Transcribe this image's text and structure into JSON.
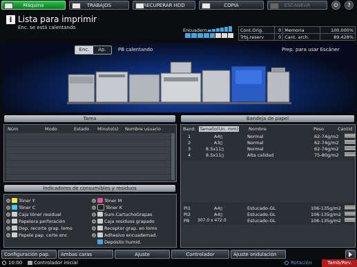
{
  "top_tabs": {
    "maquina": "Máquina",
    "trabajos": "TRABAJOS",
    "recuperar_hdd": "RECUPERAR HDD",
    "copia": "COPIA",
    "escanear": "ESCANEAR"
  },
  "status": {
    "title": "Lista para imprimir",
    "subtitle": "Enc. se está calentando",
    "toner_label": "Encuadern."
  },
  "counters": {
    "cont_orig_label": "Cont.Orig.",
    "cont_orig_value": "0",
    "memoria_label": "Memoria",
    "memoria_value": "100.000%",
    "trbj_reserv_label": "Trbj.reserv",
    "trbj_reserv_value": "0",
    "cant_arch_label": "Cant. arch.",
    "cant_arch_value": "89.428%"
  },
  "machine": {
    "enc_label": "Enc.",
    "ap_label": "Ap.",
    "pb_status": "PB calentando",
    "scanner_status": "Prep. para usar Escáner"
  },
  "tarea": {
    "header": "Tarea",
    "columns": [
      "Núm",
      "Modo",
      "Estado",
      "Minuto(s)",
      "Nombre usuario"
    ]
  },
  "consumibles": {
    "header": "Indicadores de consumibles y residuos",
    "left": [
      "Tóner Y",
      "Tóner C",
      "Caja tóner residual",
      "Papelera perforación",
      "Dep. recorte grap. lomo",
      "Papele pap. corte enc"
    ],
    "right": [
      "Tóner M",
      "Tóner K",
      "Sum.CartuchoGrapas",
      "Caja residuos grapado",
      "Receptor grap. en lomo",
      "Adhesivo encuadernad.",
      "Depósito humid."
    ]
  },
  "bandeja": {
    "header": "Bandeja de papel",
    "columns": [
      "Band.",
      "Tamaño(Un. mm)",
      "Nombre",
      "Peso",
      "Cantid"
    ],
    "rows": [
      {
        "band": "1",
        "size": "A4▯",
        "name": "Normal",
        "weight": "62-74g/m2"
      },
      {
        "band": "2",
        "size": "A3▯",
        "name": "Normal",
        "weight": "62-74g/m2"
      },
      {
        "band": "3",
        "size": "8.5x11▯",
        "name": "Normal",
        "weight": "62-74g/m2"
      },
      {
        "band": "4",
        "size": "8.5x11▯",
        "name": "Alta calidad",
        "weight": "75-80g/m2"
      }
    ],
    "rows_bottom": [
      {
        "band": "PI1",
        "size": "A4▯",
        "name": "Estucado-GL",
        "weight": "106-135g/m2"
      },
      {
        "band": "PI2",
        "size": "A4▯",
        "name": "Estucado-GL",
        "weight": "106-135g/m2"
      },
      {
        "band": "PB",
        "size": "307.0 x 472.0",
        "name": "Estucado-GL",
        "weight": "106-135g/m2"
      }
    ]
  },
  "bottom_buttons": {
    "configuracion": "Configuración pap.",
    "ambas_caras": "Ambas caras",
    "ajuste": "Ajuste",
    "controlador": "Controlador",
    "ajuste_ondulacion": "Ajuste ondulación"
  },
  "status_bar": {
    "time": "10:00",
    "controller": "Controlador inicial",
    "rotacion": "Rotación",
    "tamb_rev": "Tamb/Rev."
  }
}
